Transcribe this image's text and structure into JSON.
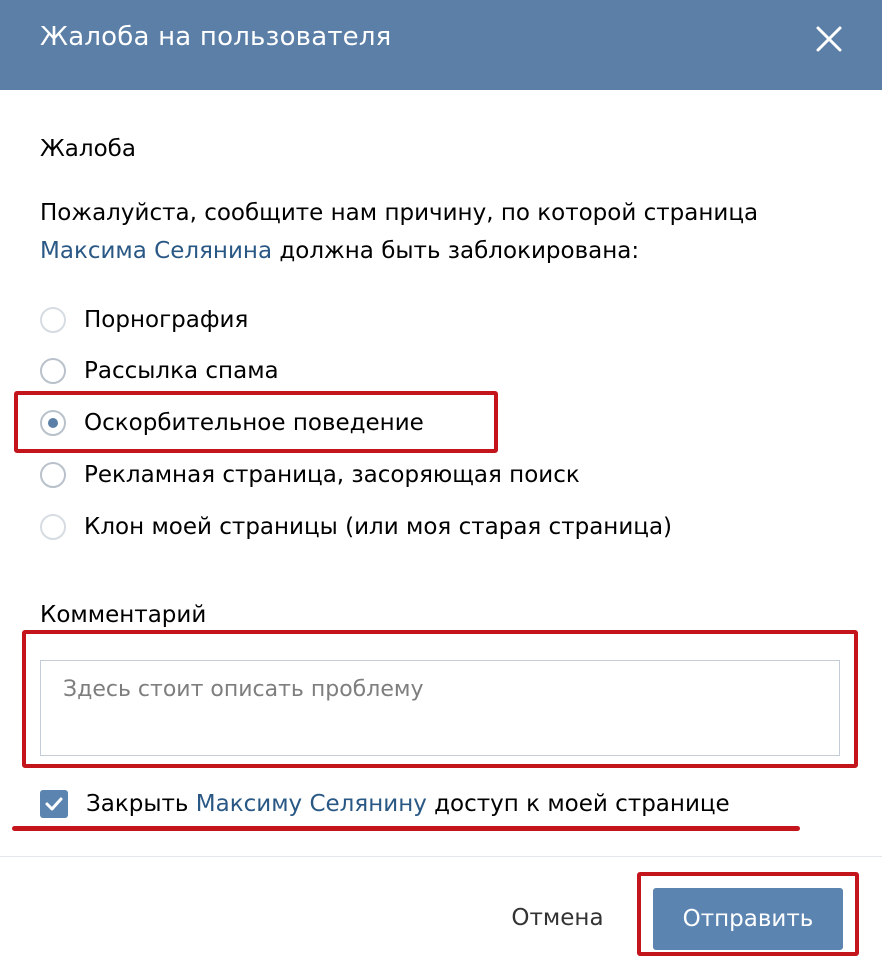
{
  "dialog": {
    "title": "Жалоба на пользователя",
    "close_icon": "close-icon"
  },
  "complaint": {
    "section_title": "Жалоба",
    "description_prefix": "Пожалуйста, сообщите нам причину, по которой страница",
    "user_link": "Максима Селянина",
    "description_suffix": " должна быть заблокирована:",
    "options": [
      {
        "label": "Порнография",
        "selected": false
      },
      {
        "label": "Рассылка спама",
        "selected": false
      },
      {
        "label": "Оскорбительное поведение",
        "selected": true
      },
      {
        "label": "Рекламная страница, засоряющая поиск",
        "selected": false
      },
      {
        "label": "Клон моей страницы (или моя старая страница)",
        "selected": false
      }
    ]
  },
  "comment": {
    "title": "Комментарий",
    "placeholder": "Здесь стоит описать проблему",
    "value": ""
  },
  "block_access": {
    "checked": true,
    "label_prefix": "Закрыть ",
    "label_user": "Максиму Селянину",
    "label_suffix": " доступ к моей странице"
  },
  "footer": {
    "cancel_label": "Отмена",
    "submit_label": "Отправить"
  },
  "colors": {
    "header_bg": "#5b7fa6",
    "button_bg": "#5b84b1",
    "link": "#2a5885",
    "annotation_red": "#c4141c"
  }
}
